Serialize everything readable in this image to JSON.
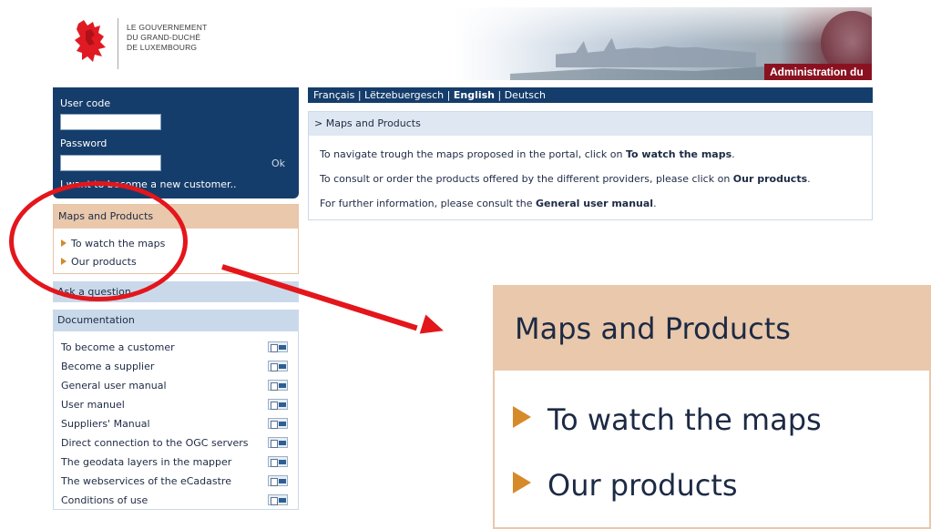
{
  "header": {
    "logo_lines": [
      "LE GOUVERNEMENT",
      "DU GRAND-DUCHÉ",
      "DE LUXEMBOURG"
    ],
    "banner_label": "Administration du"
  },
  "login": {
    "user_code_label": "User code",
    "password_label": "Password",
    "ok_label": "Ok",
    "new_customer_link": "I want to become a new customer.."
  },
  "maps_products": {
    "title": "Maps and Products",
    "items": [
      "To watch the maps",
      "Our products"
    ]
  },
  "ask_question": "Ask a question",
  "documentation": {
    "title": "Documentation",
    "items": [
      "To become a customer",
      "Become a supplier",
      "General user manual",
      "User manuel",
      "Suppliers' Manual",
      "Direct connection to the OGC servers",
      "The geodata layers in the mapper",
      "The webservices of the eCadastre",
      "Conditions of use"
    ]
  },
  "languages": {
    "items": [
      "Français",
      "Lëtzebuergesch",
      "English",
      "Deutsch"
    ],
    "active": "English",
    "separator": " | "
  },
  "content": {
    "breadcrumb": "> Maps and Products",
    "line1_pre": "To navigate trough the maps proposed in the portal, click on ",
    "line1_bold": "To watch the maps",
    "line1_post": ".",
    "line2_pre": "To consult or order the products offered by the different providers, please click on ",
    "line2_bold": "Our products",
    "line2_post": ".",
    "line3_pre": "For further information, please consult the ",
    "line3_bold": "General user manual",
    "line3_post": "."
  },
  "zoom": {
    "title": "Maps and Products",
    "items": [
      "To watch the maps",
      "Our products"
    ]
  },
  "colors": {
    "navy": "#153d6b",
    "peach": "#e9c8ab",
    "light_blue": "#cad9ea",
    "annotation_red": "#e3161c",
    "bullet_orange": "#d68a2a",
    "banner_red": "#8a1220"
  }
}
